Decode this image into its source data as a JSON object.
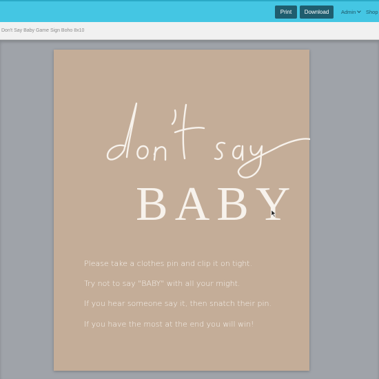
{
  "toolbar": {
    "print_label": "Print",
    "download_label": "Download",
    "admin_label": "Admin",
    "shop_label": "Shop"
  },
  "document": {
    "title": "Don't Say Baby Game Sign Boho 8x10"
  },
  "sign": {
    "script_title": "don't say",
    "main_title": "BABY",
    "lines": [
      "Please take a clothes pin and clip it on tight.",
      "Try not to say \"BABY\" with all your might.",
      "If you hear someone say it, then snatch their pin.",
      "If you have the most at the end you will  win!"
    ]
  },
  "colors": {
    "topbar": "#44c6e3",
    "button": "#1f5d6e",
    "page": "#c4ad98",
    "canvas": "#9fa3a9"
  }
}
